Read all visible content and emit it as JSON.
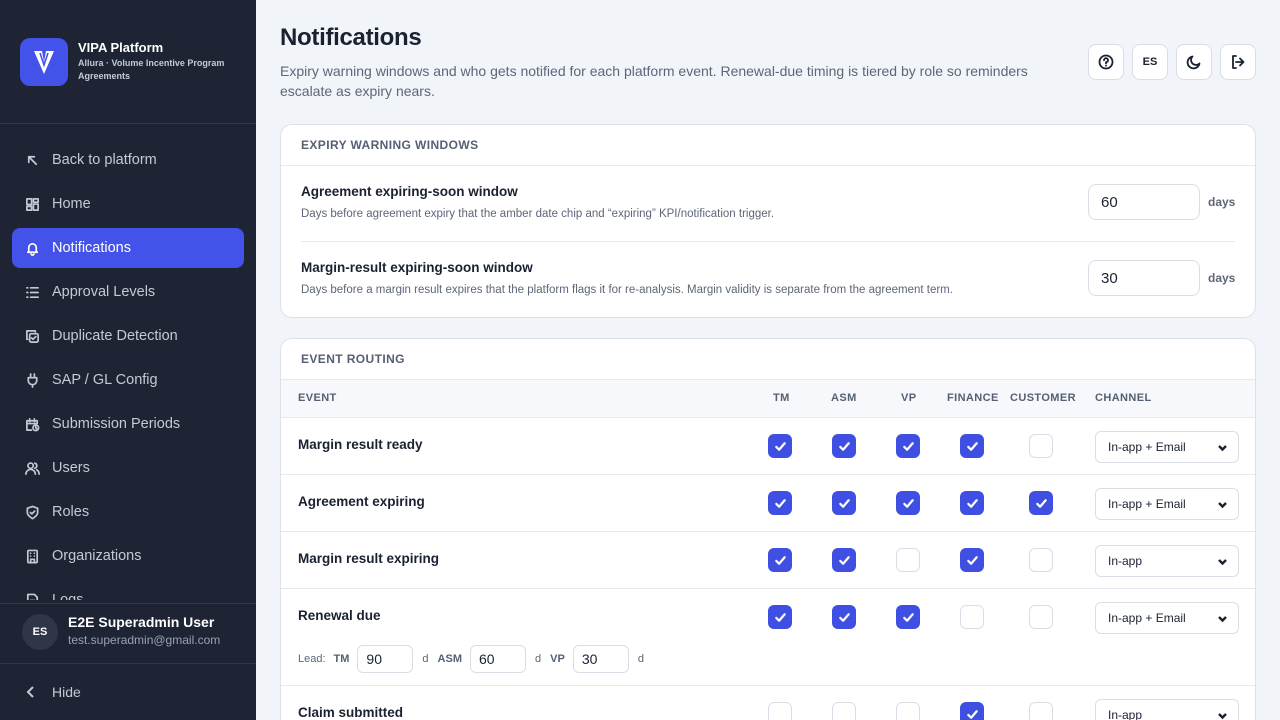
{
  "brand": {
    "name": "VIPA Platform",
    "subtitle": "Allura · Volume Incentive Program Agreements"
  },
  "nav": [
    {
      "label": "Back to platform",
      "icon": "arrow-up-left-icon",
      "active": false
    },
    {
      "label": "Home",
      "icon": "grid-icon",
      "active": false
    },
    {
      "label": "Notifications",
      "icon": "bell-icon",
      "active": true
    },
    {
      "label": "Approval Levels",
      "icon": "list-icon",
      "active": false
    },
    {
      "label": "Duplicate Detection",
      "icon": "copy-check-icon",
      "active": false
    },
    {
      "label": "SAP / GL Config",
      "icon": "plug-icon",
      "active": false
    },
    {
      "label": "Submission Periods",
      "icon": "calendar-clock-icon",
      "active": false
    },
    {
      "label": "Users",
      "icon": "users-icon",
      "active": false
    },
    {
      "label": "Roles",
      "icon": "shield-icon",
      "active": false
    },
    {
      "label": "Organizations",
      "icon": "building-icon",
      "active": false
    },
    {
      "label": "Logs",
      "icon": "logs-icon",
      "active": false
    }
  ],
  "user": {
    "initials": "ES",
    "name": "E2E Superadmin User",
    "email": "test.superadmin@gmail.com"
  },
  "hide_label": "Hide",
  "header": {
    "title": "Notifications",
    "description": "Expiry warning windows and who gets notified for each platform event. Renewal-due timing is tiered by role so reminders escalate as expiry nears.",
    "lang_label": "ES"
  },
  "expiry": {
    "title": "EXPIRY WARNING WINDOWS",
    "settings": [
      {
        "label": "Agreement expiring-soon window",
        "help": "Days before agreement expiry that the amber date chip and “expiring” KPI/notification trigger.",
        "value": "60",
        "unit": "days"
      },
      {
        "label": "Margin-result expiring-soon window",
        "help": "Days before a margin result expires that the platform flags it for re-analysis. Margin validity is separate from the agreement term.",
        "value": "30",
        "unit": "days"
      }
    ]
  },
  "routing": {
    "title": "EVENT ROUTING",
    "columns": {
      "event": "EVENT",
      "tm": "TM",
      "asm": "ASM",
      "vp": "VP",
      "finance": "FINANCE",
      "customer": "CUSTOMER",
      "channel": "CHANNEL"
    },
    "rows": [
      {
        "event": "Margin result ready",
        "checks": [
          true,
          true,
          true,
          true,
          false
        ],
        "channel": "In-app + Email"
      },
      {
        "event": "Agreement expiring",
        "checks": [
          true,
          true,
          true,
          true,
          true
        ],
        "channel": "In-app + Email"
      },
      {
        "event": "Margin result expiring",
        "checks": [
          true,
          true,
          false,
          true,
          false
        ],
        "channel": "In-app"
      },
      {
        "event": "Renewal due",
        "checks": [
          true,
          true,
          true,
          false,
          false
        ],
        "channel": "In-app + Email",
        "lead": {
          "label": "Lead:",
          "tm_label": "TM",
          "tm": "90",
          "asm_label": "ASM",
          "asm": "60",
          "vp_label": "VP",
          "vp": "30",
          "unit": "d"
        }
      },
      {
        "event": "Claim submitted",
        "checks": [
          false,
          false,
          false,
          true,
          false
        ],
        "channel": "In-app"
      }
    ]
  },
  "colors": {
    "accent": "#4352e8",
    "sidebar": "#1e2433",
    "background": "#f1f4f9"
  }
}
